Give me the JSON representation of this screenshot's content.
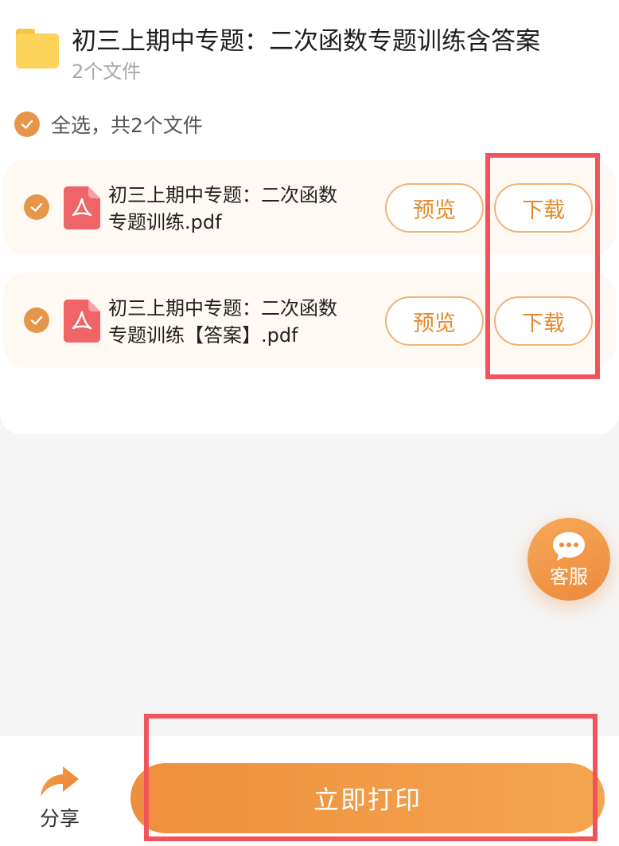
{
  "folder": {
    "title": "初三上期中专题：二次函数专题训练含答案",
    "subtitle": "2个文件"
  },
  "select_all": {
    "label": "全选，共2个文件"
  },
  "files": [
    {
      "name": "初三上期中专题：二次函数专题训练.pdf",
      "preview_label": "预览",
      "download_label": "下载"
    },
    {
      "name": "初三上期中专题：二次函数专题训练【答案】.pdf",
      "preview_label": "预览",
      "download_label": "下载"
    }
  ],
  "service": {
    "label": "客服"
  },
  "bottom": {
    "share_label": "分享",
    "print_label": "立即打印"
  },
  "colors": {
    "accent": "#e6964a",
    "button_text": "#e58a2c",
    "highlight": "#f2545b",
    "pdf": "#ef6467",
    "folder": "#fbd459"
  }
}
